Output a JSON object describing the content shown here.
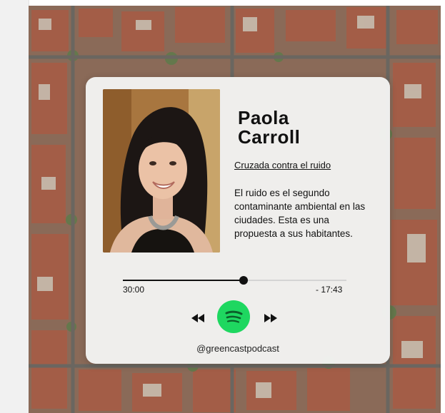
{
  "episode": {
    "name_line1": "Paola",
    "name_line2": "Carroll",
    "title": "Cruzada contra el ruido",
    "description": "El ruido es el segundo contaminante ambiental en las ciudades. Esta es una propuesta a sus habitantes."
  },
  "player": {
    "elapsed": "30:00",
    "remaining": "- 17:43",
    "progress_fraction": 0.54
  },
  "footer": {
    "handle": "@greencastpodcast"
  },
  "colors": {
    "spotify_green": "#1ed760",
    "card_bg": "#f4f4f2"
  },
  "icons": [
    "rewind-icon",
    "spotify-icon",
    "fast-forward-icon"
  ]
}
